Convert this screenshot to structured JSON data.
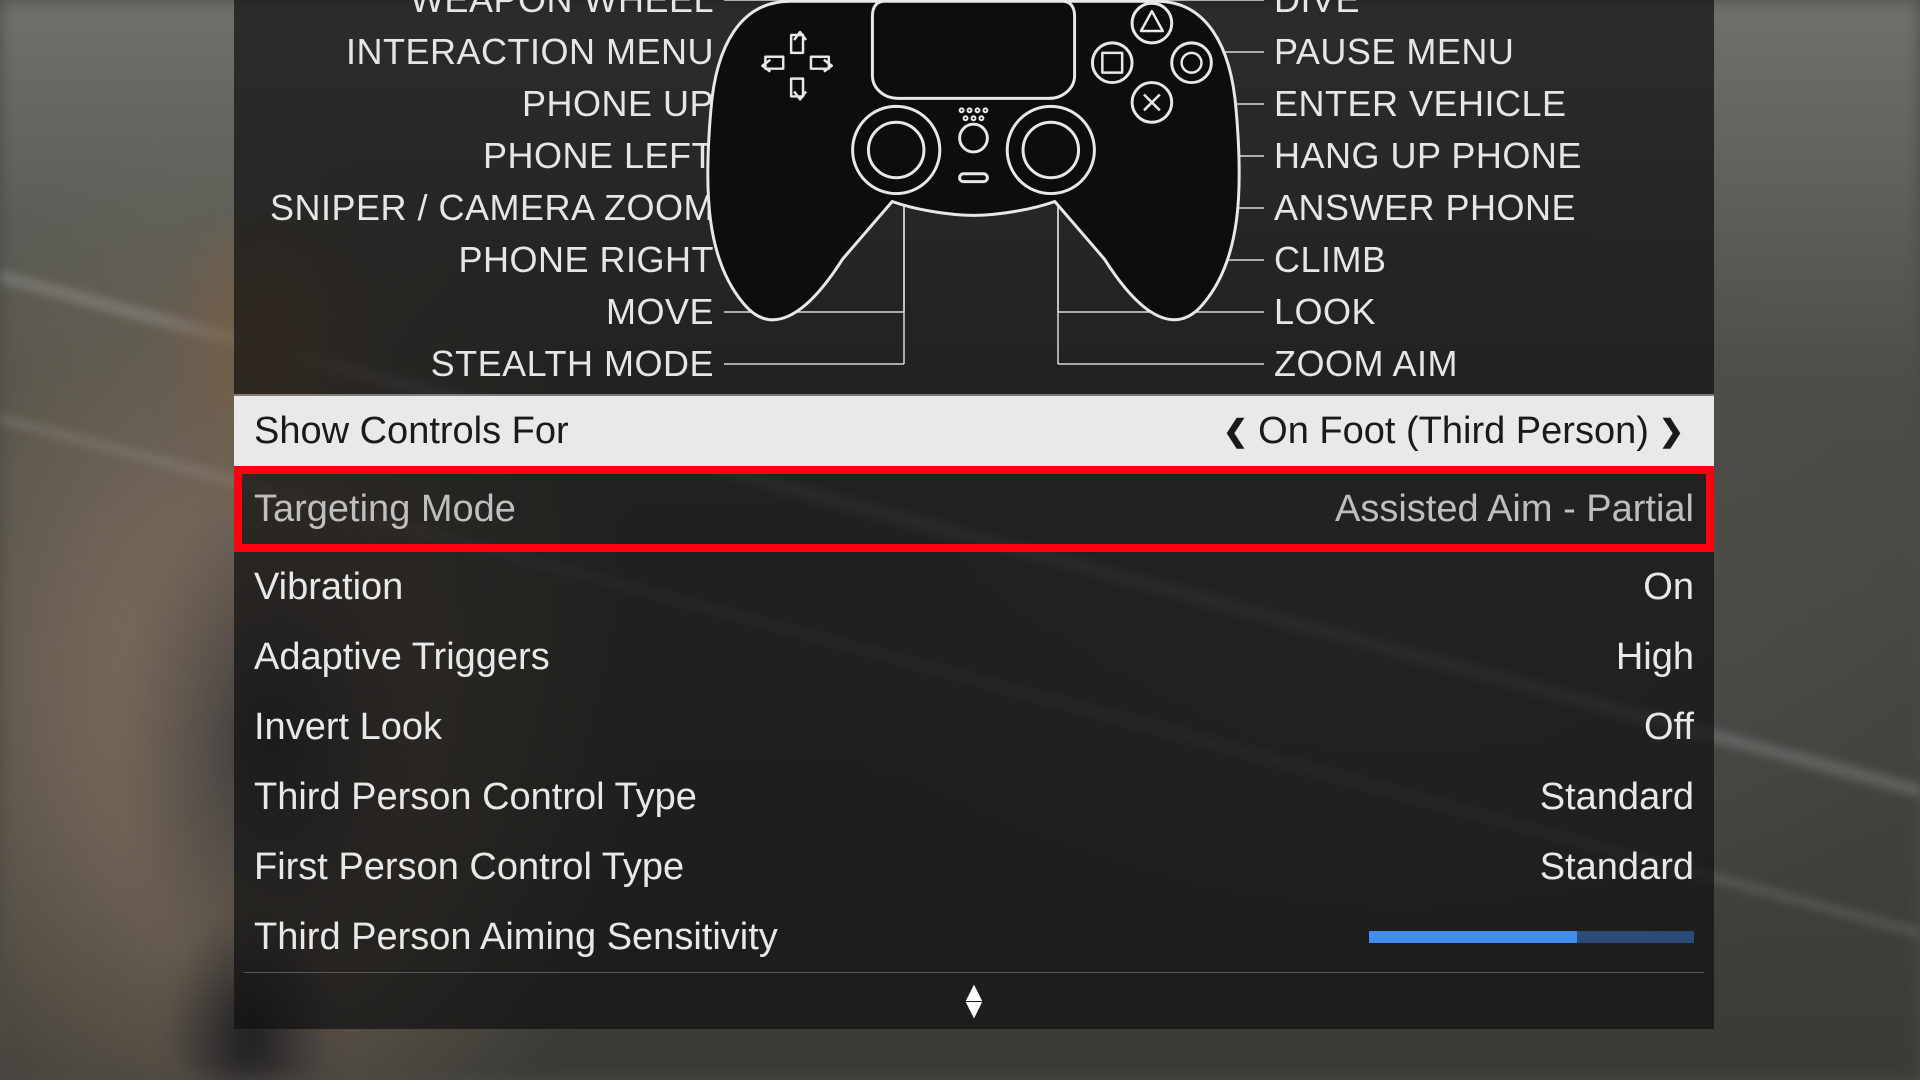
{
  "controller_labels_left": [
    "WEAPON WHEEL",
    "INTERACTION MENU",
    "PHONE UP",
    "PHONE LEFT",
    "SNIPER / CAMERA ZOOM",
    "PHONE RIGHT",
    "MOVE",
    "STEALTH MODE"
  ],
  "controller_labels_right": [
    "DIVE",
    "PAUSE MENU",
    "ENTER VEHICLE",
    "HANG UP PHONE",
    "ANSWER PHONE",
    "CLIMB",
    "LOOK",
    "ZOOM AIM"
  ],
  "selector": {
    "label": "Show Controls For",
    "value": "On Foot (Third Person)"
  },
  "highlighted": {
    "label": "Targeting Mode",
    "value": "Assisted Aim - Partial"
  },
  "options": [
    {
      "label": "Vibration",
      "value": "On"
    },
    {
      "label": "Adaptive Triggers",
      "value": "High"
    },
    {
      "label": "Invert Look",
      "value": "Off"
    },
    {
      "label": "Third Person Control Type",
      "value": "Standard"
    },
    {
      "label": "First Person Control Type",
      "value": "Standard"
    }
  ],
  "slider_option": {
    "label": "Third Person Aiming Sensitivity",
    "percent": 64
  }
}
